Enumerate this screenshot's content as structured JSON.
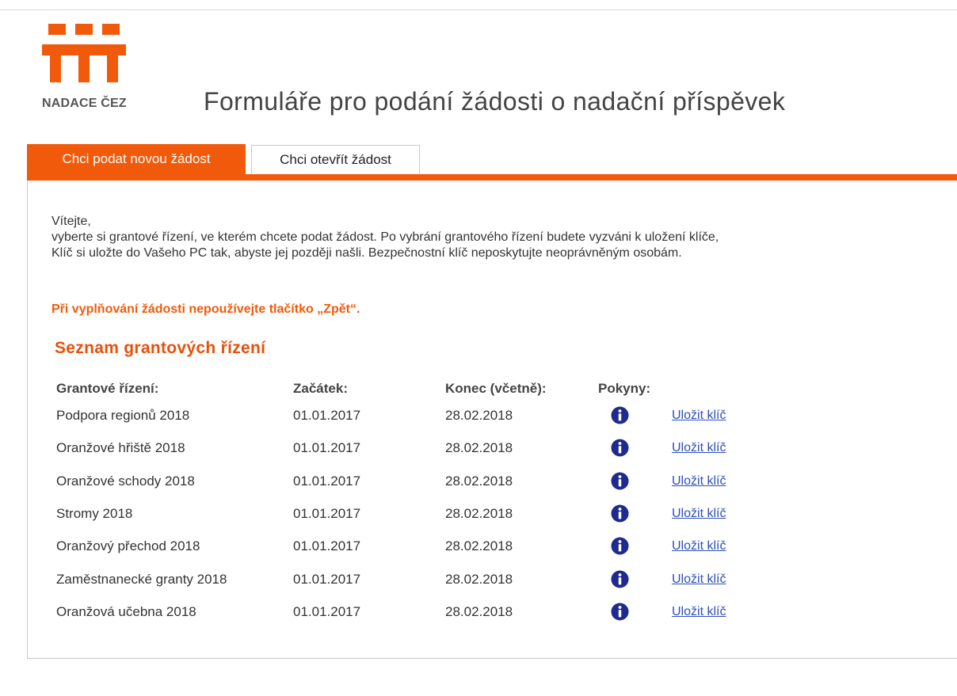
{
  "logo": {
    "text": "NADACE ČEZ",
    "color": "#f05a0a"
  },
  "page_title": "Formuláře pro podání žádosti o nadační příspěvek",
  "tabs": [
    {
      "label": "Chci podat novou žádost",
      "active": true
    },
    {
      "label": "Chci otevřít žádost",
      "active": false
    }
  ],
  "intro": {
    "greeting": "Vítejte,",
    "line1": "vyberte si grantové řízení, ve kterém chcete podat žádost. Po vybrání grantového řízení budete vyzváni k uložení klíče,",
    "line2": "Klíč si uložte do Vašeho PC tak, abyste jej později našli. Bezpečnostní klíč neposkytujte neoprávněným osobám."
  },
  "warning": "Při vyplňování žádosti nepoužívejte tlačítko „Zpět“.",
  "list": {
    "heading": "Seznam grantových řízení",
    "columns": {
      "name": "Grantové řízení:",
      "start": "Začátek:",
      "end": "Konec (včetně):",
      "instructions": "Pokyny:"
    },
    "rows": [
      {
        "name": "Podpora regionů 2018",
        "start": "01.01.2017",
        "end": "28.02.2018",
        "info_icon": "info-icon",
        "link": "Uložit klíč"
      },
      {
        "name": "Oranžové hřiště 2018",
        "start": "01.01.2017",
        "end": "28.02.2018",
        "info_icon": "info-icon",
        "link": "Uložit klíč"
      },
      {
        "name": "Oranžové schody 2018",
        "start": "01.01.2017",
        "end": "28.02.2018",
        "info_icon": "info-icon",
        "link": "Uložit klíč"
      },
      {
        "name": "Stromy 2018",
        "start": "01.01.2017",
        "end": "28.02.2018",
        "info_icon": "info-icon",
        "link": "Uložit klíč"
      },
      {
        "name": "Oranžový přechod 2018",
        "start": "01.01.2017",
        "end": "28.02.2018",
        "info_icon": "info-icon",
        "link": "Uložit klíč"
      },
      {
        "name": "Zaměstnanecké granty 2018",
        "start": "01.01.2017",
        "end": "28.02.2018",
        "info_icon": "info-icon",
        "link": "Uložit klíč"
      },
      {
        "name": "Oranžová učebna 2018",
        "start": "01.01.2017",
        "end": "28.02.2018",
        "info_icon": "info-icon",
        "link": "Uložit klíč"
      }
    ]
  },
  "colors": {
    "accent": "#f05a0a",
    "link": "#2d4fb8",
    "info_icon": "#1e2a8c"
  }
}
